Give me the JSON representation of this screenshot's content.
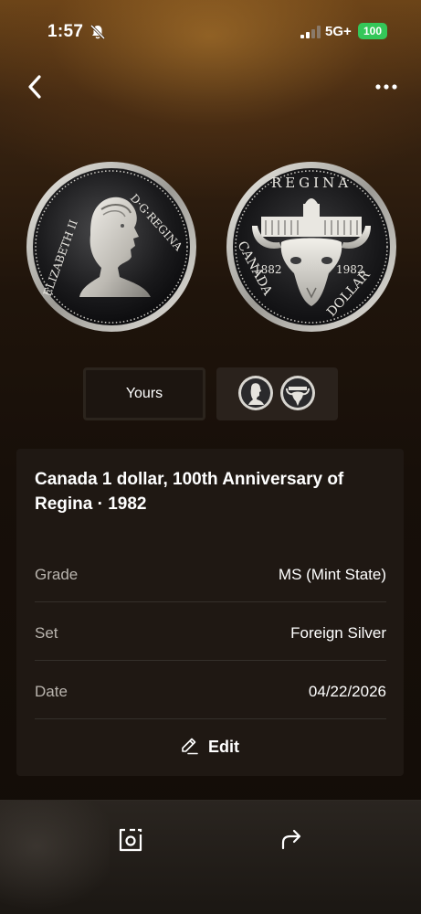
{
  "status_bar": {
    "time": "1:57",
    "network": "5G+",
    "battery": "100",
    "battery_color": "#34c759"
  },
  "nav": {
    "back_icon": "chevron-left-icon",
    "more_icon": "more-horizontal-icon"
  },
  "coin": {
    "obverse_legend_left": "ELIZABETH II",
    "obverse_legend_right": "D·G·REGINA",
    "reverse_legend_top": "REGINA",
    "reverse_year_left": "1882",
    "reverse_year_right": "1982",
    "reverse_legend_bottom_left": "CANADA",
    "reverse_legend_bottom_right": "DOLLAR"
  },
  "selector": {
    "yours_label": "Yours"
  },
  "details": {
    "title": "Canada 1 dollar, 100th Anniversary of Regina · 1982",
    "rows": [
      {
        "label": "Grade",
        "value": "MS (Mint State)"
      },
      {
        "label": "Set",
        "value": "Foreign Silver"
      },
      {
        "label": "Date",
        "value": "04/22/2026"
      }
    ],
    "edit_label": "Edit"
  },
  "bottom_bar": {
    "photo_icon": "camera-frame-icon",
    "share_icon": "share-arrow-icon"
  }
}
